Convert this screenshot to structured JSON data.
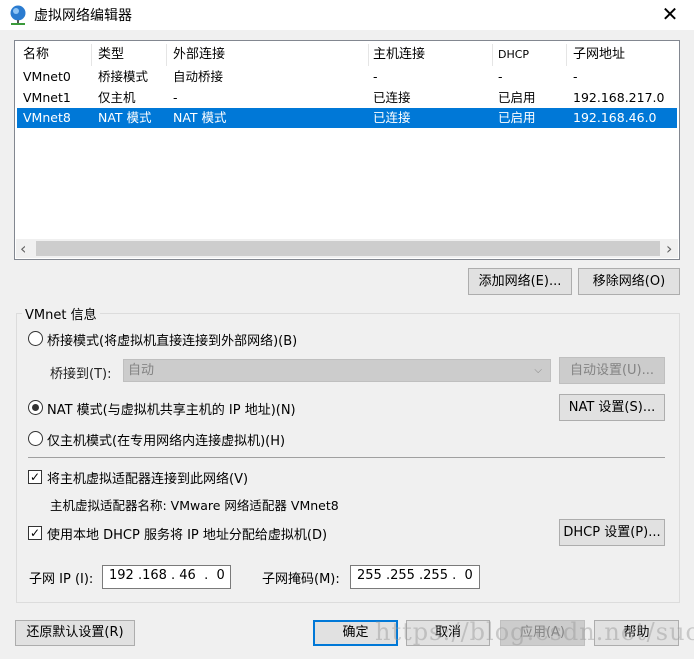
{
  "window": {
    "title": "虚拟网络编辑器",
    "close": "✕",
    "icon": "network-globe-icon"
  },
  "table": {
    "columns": [
      "名称",
      "类型",
      "外部连接",
      "主机连接",
      "DHCP",
      "子网地址"
    ],
    "rows": [
      [
        "VMnet0",
        "桥接模式",
        "自动桥接",
        "-",
        "-",
        "-"
      ],
      [
        "VMnet1",
        "仅主机",
        "-",
        "已连接",
        "已启用",
        "192.168.217.0"
      ],
      [
        "VMnet8",
        "NAT 模式",
        "NAT 模式",
        "已连接",
        "已启用",
        "192.168.46.0"
      ]
    ],
    "selected_row": 2,
    "scroll_left": "‹",
    "scroll_right": "›"
  },
  "buttons": {
    "add": "添加网络(E)...",
    "remove": "移除网络(O)",
    "auto": "自动设置(U)...",
    "nat": "NAT 设置(S)...",
    "dhcp": "DHCP 设置(P)...",
    "restore": "还原默认设置(R)",
    "ok": "确定",
    "cancel": "取消",
    "apply": "应用(A)",
    "help": "帮助"
  },
  "info": {
    "group_label": "VMnet 信息",
    "bridge_radio": "桥接模式(将虚拟机直接连接到外部网络)(B)",
    "bridge_to_label": "桥接到(T):",
    "bridge_to_value": "自动",
    "nat_radio": "NAT 模式(与虚拟机共享主机的 IP 地址)(N)",
    "host_radio": "仅主机模式(在专用网络内连接虚拟机)(H)",
    "selected_mode": "nat",
    "connect_adapter": "将主机虚拟适配器连接到此网络(V)",
    "connect_adapter_checked": true,
    "adapter_name": "主机虚拟适配器名称: VMware 网络适配器 VMnet8",
    "use_dhcp": "使用本地 DHCP 服务将 IP 地址分配给虚拟机(D)",
    "use_dhcp_checked": true,
    "subnet_ip_label": "子网 IP (I):",
    "subnet_ip": "192 .168 . 46  .  0",
    "subnet_mask_label": "子网掩码(M):",
    "subnet_mask": "255 .255 .255 .  0"
  },
  "watermark": "https://blog.csdn.net/suoyudong"
}
